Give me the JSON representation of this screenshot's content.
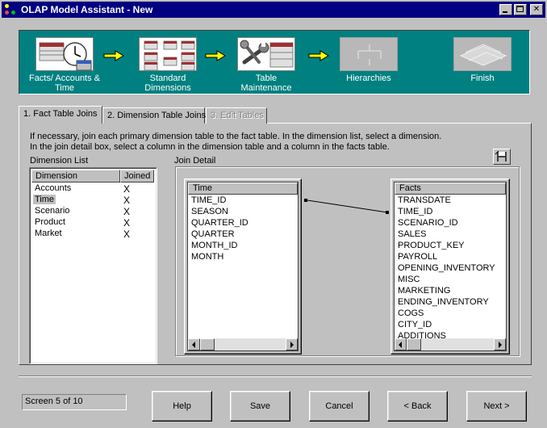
{
  "window": {
    "title": "OLAP Model Assistant - New"
  },
  "steps": [
    {
      "label": "Facts/ Accounts &\nTime",
      "icon": "clock-table-icon",
      "enabled": true
    },
    {
      "label": "Standard\nDimensions",
      "icon": "tables-icon",
      "enabled": true
    },
    {
      "label": "Table\nMaintenance",
      "icon": "wrench-table-icon",
      "enabled": true
    },
    {
      "label": "Hierarchies",
      "icon": "hierarchy-icon",
      "enabled": false
    },
    {
      "label": "Finish",
      "icon": "finish-icon",
      "enabled": false
    }
  ],
  "tabs": [
    {
      "label": "1. Fact Table Joins",
      "active": true
    },
    {
      "label": "2. Dimension Table Joins",
      "active": false
    },
    {
      "label": "3. Edit Tables",
      "active": false,
      "disabled": true
    }
  ],
  "instructions": {
    "line1": "If necessary, join each primary dimension table to the fact table.  In the dimension list, select a dimension.",
    "line2": "In the join detail box, select a column in the dimension table and a column in the facts table."
  },
  "dimension_list": {
    "label": "Dimension List",
    "columns": [
      "Dimension",
      "Joined"
    ],
    "rows": [
      {
        "dimension": "Accounts",
        "joined": "X"
      },
      {
        "dimension": "Time",
        "joined": "X",
        "selected": true
      },
      {
        "dimension": "Scenario",
        "joined": "X"
      },
      {
        "dimension": "Product",
        "joined": "X"
      },
      {
        "dimension": "Market",
        "joined": "X"
      }
    ]
  },
  "join_detail": {
    "label": "Join Detail",
    "dimension_table": {
      "name": "Time",
      "columns": [
        "TIME_ID",
        "SEASON",
        "QUARTER_ID",
        "QUARTER",
        "MONTH_ID",
        "MONTH"
      ]
    },
    "fact_table": {
      "name": "Facts",
      "columns": [
        "TRANSDATE",
        "TIME_ID",
        "SCENARIO_ID",
        "SALES",
        "PRODUCT_KEY",
        "PAYROLL",
        "OPENING_INVENTORY",
        "MISC",
        "MARKETING",
        "ENDING_INVENTORY",
        "COGS",
        "CITY_ID",
        "ADDITIONS"
      ]
    },
    "join": {
      "from": "TIME_ID",
      "to": "TIME_ID"
    }
  },
  "status": {
    "screen": "Screen 5 of 10"
  },
  "buttons": {
    "help": "Help",
    "save": "Save",
    "cancel": "Cancel",
    "back": "< Back",
    "next": "Next >"
  },
  "colors": {
    "titlebar": "#000080",
    "banner": "#008080",
    "face": "#c0c0c0",
    "arrow": "#ffff00"
  }
}
